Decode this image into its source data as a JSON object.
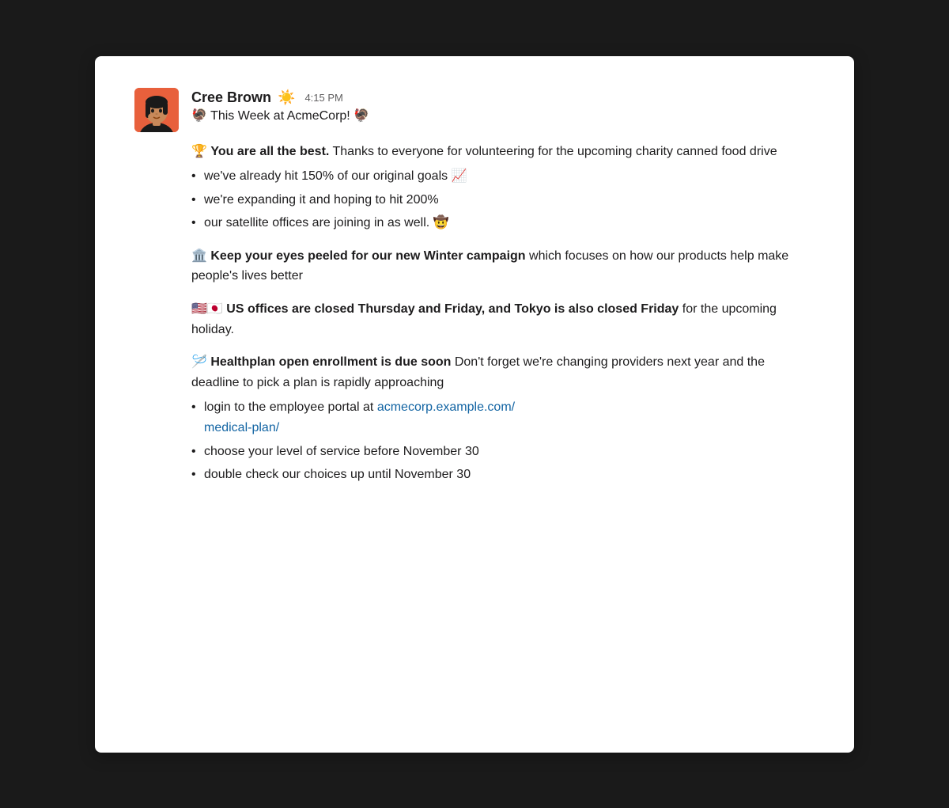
{
  "card": {
    "background_color": "#ffffff"
  },
  "user": {
    "name": "Cree Brown",
    "status_emoji": "☀️",
    "timestamp": "4:15 PM",
    "subject": "🦃 This Week at AcmeCorp! 🦃"
  },
  "sections": [
    {
      "id": "charity",
      "intro_emoji": "🏆",
      "bold_text": "You are all the best.",
      "regular_text": " Thanks to everyone for volunteering for the upcoming charity canned food drive",
      "bullets": [
        "we've already hit 150% of our original goals 📈",
        "we're expanding it and hoping to hit 200%",
        "our satellite offices are joining in as well. 🤠"
      ]
    },
    {
      "id": "winter",
      "intro_emoji": "🏛️",
      "bold_text": "Keep your eyes peeled for our new Winter campaign",
      "regular_text": " which focuses on how our products help make people's lives better",
      "bullets": []
    },
    {
      "id": "offices",
      "intro_emoji": "🇺🇸🇯🇵",
      "bold_text": "US offices are closed Thursday and Friday, and Tokyo is also closed Friday",
      "regular_text": " for the upcoming holiday.",
      "bullets": []
    },
    {
      "id": "healthplan",
      "intro_emoji": "🪡",
      "bold_text": "Healthplan open enrollment is due soon",
      "regular_text": " Don't forget we're changing providers next year and the deadline to pick a plan is rapidly approaching",
      "bullets": [
        "login_special",
        "choose your level of service before November 30",
        "double check our choices up until November 30"
      ],
      "link_text": "acmecorp.example.com/medical-plan/",
      "link_href": "acmecorp.example.com/medical-plan/"
    }
  ],
  "labels": {
    "link_prefix": "login to the employee portal at "
  }
}
